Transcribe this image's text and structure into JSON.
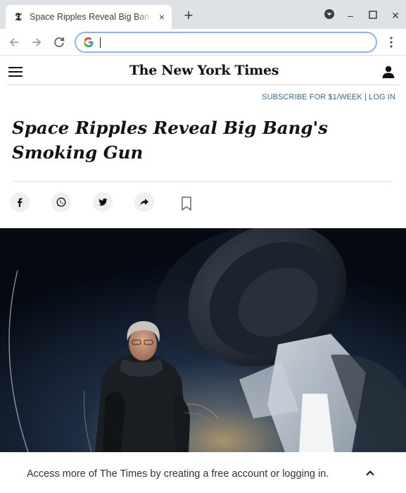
{
  "browser": {
    "tab": {
      "favicon": "𝕿",
      "title": "Space Ripples Reveal Big Bang's Smoking Gun",
      "close_icon": "×"
    },
    "new_tab_icon": "+",
    "window_controls": {
      "profile_icon": "chevron-down-circle-icon",
      "minimize": "–",
      "maximize": "☐",
      "close": "✕"
    },
    "omnibox": {
      "value": "",
      "placeholder": ""
    }
  },
  "site": {
    "logo": "The New York Times",
    "subscribe_text": "SUBSCRIBE FOR $1/WEEK | LOG IN"
  },
  "article": {
    "headline": "Space Ripples Reveal Big Bang's Smoking Gun",
    "share_icons": [
      "facebook-icon",
      "whatsapp-icon",
      "twitter-icon",
      "share-arrow-icon",
      "bookmark-icon"
    ],
    "photo_description": "Scientist in dark jacket standing in front of a telescope at night"
  },
  "banner": {
    "text": "Access more of The Times by creating a free account or logging in."
  },
  "colors": {
    "tabbar": "#dee1e6",
    "omnibox_border": "#8ab4f8",
    "subscribe_link": "#326891",
    "headline": "#121212"
  }
}
